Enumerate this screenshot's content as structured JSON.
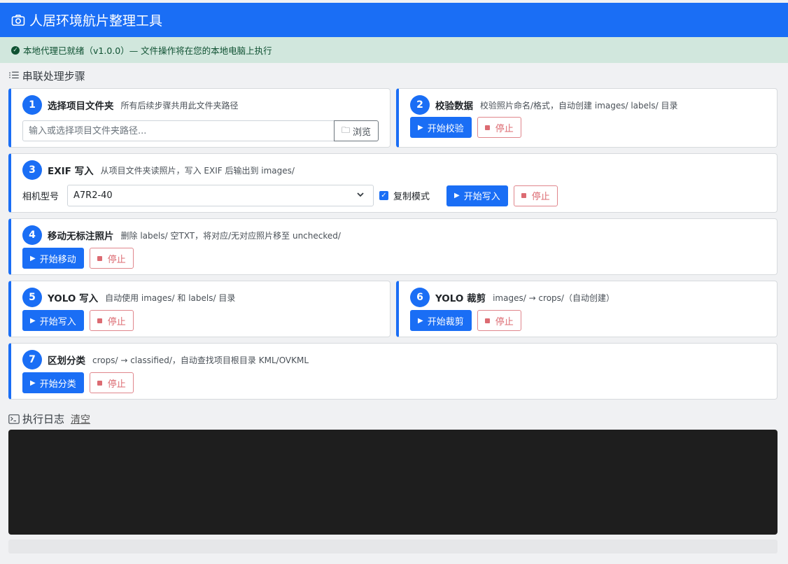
{
  "app": {
    "title": "人居环境航片整理工具",
    "accent": "#1a6ef5"
  },
  "status": {
    "text": "本地代理已就绪（v1.0.0）— 文件操作将在您的本地电脑上执行",
    "color": "#d1e7dd"
  },
  "steps_header": "串联处理步骤",
  "common": {
    "stop_label": "停止"
  },
  "step1": {
    "num": "1",
    "title": "选择项目文件夹",
    "desc": "所有后续步骤共用此文件夹路径",
    "input_placeholder": "输入或选择项目文件夹路径...",
    "input_value": "",
    "browse_label": "浏览"
  },
  "step2": {
    "num": "2",
    "title": "校验数据",
    "desc": "校验照片命名/格式，自动创建 images/ labels/ 目录",
    "start_label": "开始校验"
  },
  "step3": {
    "num": "3",
    "title": "EXIF 写入",
    "desc": "从项目文件夹读照片，写入 EXIF 后输出到 images/",
    "camera_label": "相机型号",
    "camera_value": "A7R2-40",
    "copy_mode_label": "复制模式",
    "copy_mode_checked": true,
    "start_label": "开始写入"
  },
  "step4": {
    "num": "4",
    "title": "移动无标注照片",
    "desc": "删除 labels/ 空TXT，将对应/无对应照片移至 unchecked/",
    "start_label": "开始移动"
  },
  "step5": {
    "num": "5",
    "title": "YOLO 写入",
    "desc": "自动使用 images/ 和 labels/ 目录",
    "start_label": "开始写入"
  },
  "step6": {
    "num": "6",
    "title": "YOLO 裁剪",
    "desc": "images/ → crops/（自动创建）",
    "start_label": "开始裁剪"
  },
  "step7": {
    "num": "7",
    "title": "区划分类",
    "desc": "crops/ → classified/，自动查找项目根目录 KML/OVKML",
    "start_label": "开始分类"
  },
  "log": {
    "title": "执行日志",
    "clear_label": "清空"
  }
}
